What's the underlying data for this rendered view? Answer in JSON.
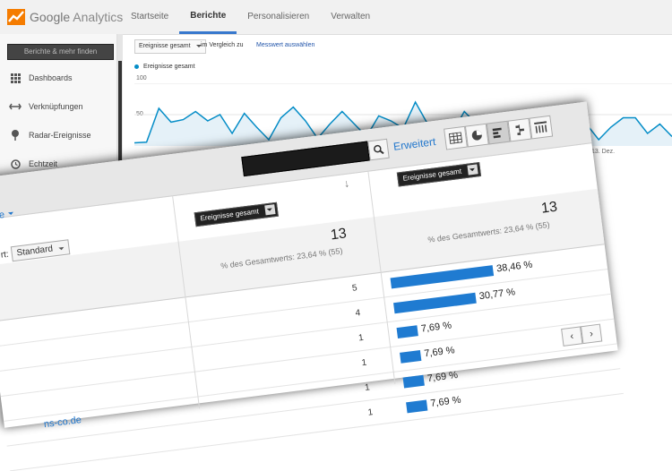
{
  "app": {
    "name_google": "Google",
    "name_analytics": "Analytics",
    "brand_color": "#f57c00",
    "accent_color": "#3778cd",
    "link_color": "#2277cc"
  },
  "nav": {
    "tabs": [
      {
        "label": "Startseite",
        "active": false
      },
      {
        "label": "Berichte",
        "active": true
      },
      {
        "label": "Personalisieren",
        "active": false
      },
      {
        "label": "Verwalten",
        "active": false
      }
    ]
  },
  "sidebar": {
    "search_placeholder": "Berichte & mehr finden",
    "items": [
      {
        "label": "Dashboards",
        "icon": "grid-icon"
      },
      {
        "label": "Verknüpfungen",
        "icon": "shortcut-arrow-icon"
      },
      {
        "label": "Radar-Ereignisse",
        "icon": "pin-icon"
      },
      {
        "label": "Echtzeit",
        "icon": "clock-icon"
      }
    ]
  },
  "chart_header": {
    "metric_select": "Ereignisse gesamt",
    "compare_text": "im Vergleich zu",
    "choose_metric_link": "Messwert auswählen"
  },
  "chart_data": {
    "type": "line",
    "series": [
      {
        "name": "Ereignisse gesamt",
        "color": "#058dc7",
        "values": [
          5,
          6,
          60,
          38,
          42,
          55,
          40,
          50,
          20,
          52,
          30,
          10,
          45,
          62,
          40,
          12,
          35,
          55,
          35,
          15,
          48,
          40,
          28,
          70,
          35,
          10,
          20,
          55,
          35,
          25,
          45,
          20,
          35,
          42,
          15,
          10,
          40,
          35,
          10,
          30,
          45,
          45,
          20,
          35,
          15
        ]
      }
    ],
    "ylim": [
      0,
      100
    ],
    "yticks": [
      "100",
      "50"
    ],
    "x_tick_label": "13. Dez."
  },
  "panel": {
    "search_value": "",
    "advanced_link": "Erweitert",
    "left_link": "re",
    "sort_label": "rt:",
    "sort_value": "Standard",
    "col1_select": "Ereignisse gesamt",
    "col2_select": "Ereignisse gesamt",
    "col1_total": "13",
    "col1_pct": "% des Gesamtwerts: 23,64 % (55)",
    "col2_total": "13",
    "col2_pct": "% des Gesamtwerts: 23,64 % (55)",
    "row_link_text": "ns-co.de",
    "rows": [
      {
        "count": "5",
        "pct": "38,46 %",
        "value": 38.46
      },
      {
        "count": "4",
        "pct": "30,77 %",
        "value": 30.77
      },
      {
        "count": "1",
        "pct": "7,69 %",
        "value": 7.69
      },
      {
        "count": "1",
        "pct": "7,69 %",
        "value": 7.69
      },
      {
        "count": "1",
        "pct": "7,69 %",
        "value": 7.69
      },
      {
        "count": "1",
        "pct": "7,69 %",
        "value": 7.69
      }
    ],
    "view_buttons": [
      "table-view-icon",
      "pie-view-icon",
      "bar-view-icon",
      "compare-view-icon",
      "pivot-view-icon"
    ],
    "active_view": 2
  }
}
